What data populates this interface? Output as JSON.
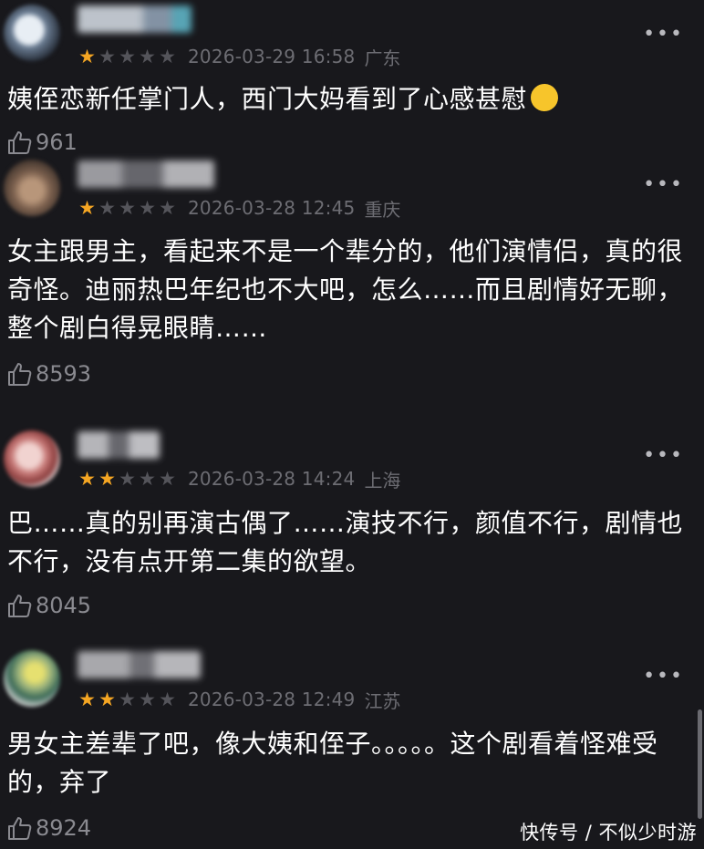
{
  "comments": [
    {
      "date": "2026-03-29 16:58",
      "region": "广东",
      "stars": 1,
      "text": "姨侄恋新任掌门人，西门大妈看到了心感甚慰",
      "likes": "961",
      "emoji": "rolling-on-floor-laughing"
    },
    {
      "date": "2026-03-28 12:45",
      "region": "重庆",
      "stars": 1,
      "text": "女主跟男主，看起来不是一个辈分的，他们演情侣，真的很奇怪。迪丽热巴年纪也不大吧，怎么……而且剧情好无聊，整个剧白得晃眼睛……",
      "likes": "8593"
    },
    {
      "date": "2026-03-28 14:24",
      "region": "上海",
      "stars": 2,
      "text": "巴……真的别再演古偶了……演技不行，颜值不行，剧情也不行，没有点开第二集的欲望。",
      "likes": "8045"
    },
    {
      "date": "2026-03-28 12:49",
      "region": "江苏",
      "stars": 2,
      "text": "男女主差辈了吧，像大姨和侄子。。。。。这个剧看着怪难受的，弃了",
      "likes": "8924"
    }
  ],
  "more_label": "•••",
  "star_full": "★",
  "star_empty": "★",
  "watermark": "快传号 / 不似少时游",
  "colors": {
    "background": "#18181c",
    "star_on": "#f5a623",
    "star_off": "#54545a",
    "meta_text": "#6d6d73"
  }
}
